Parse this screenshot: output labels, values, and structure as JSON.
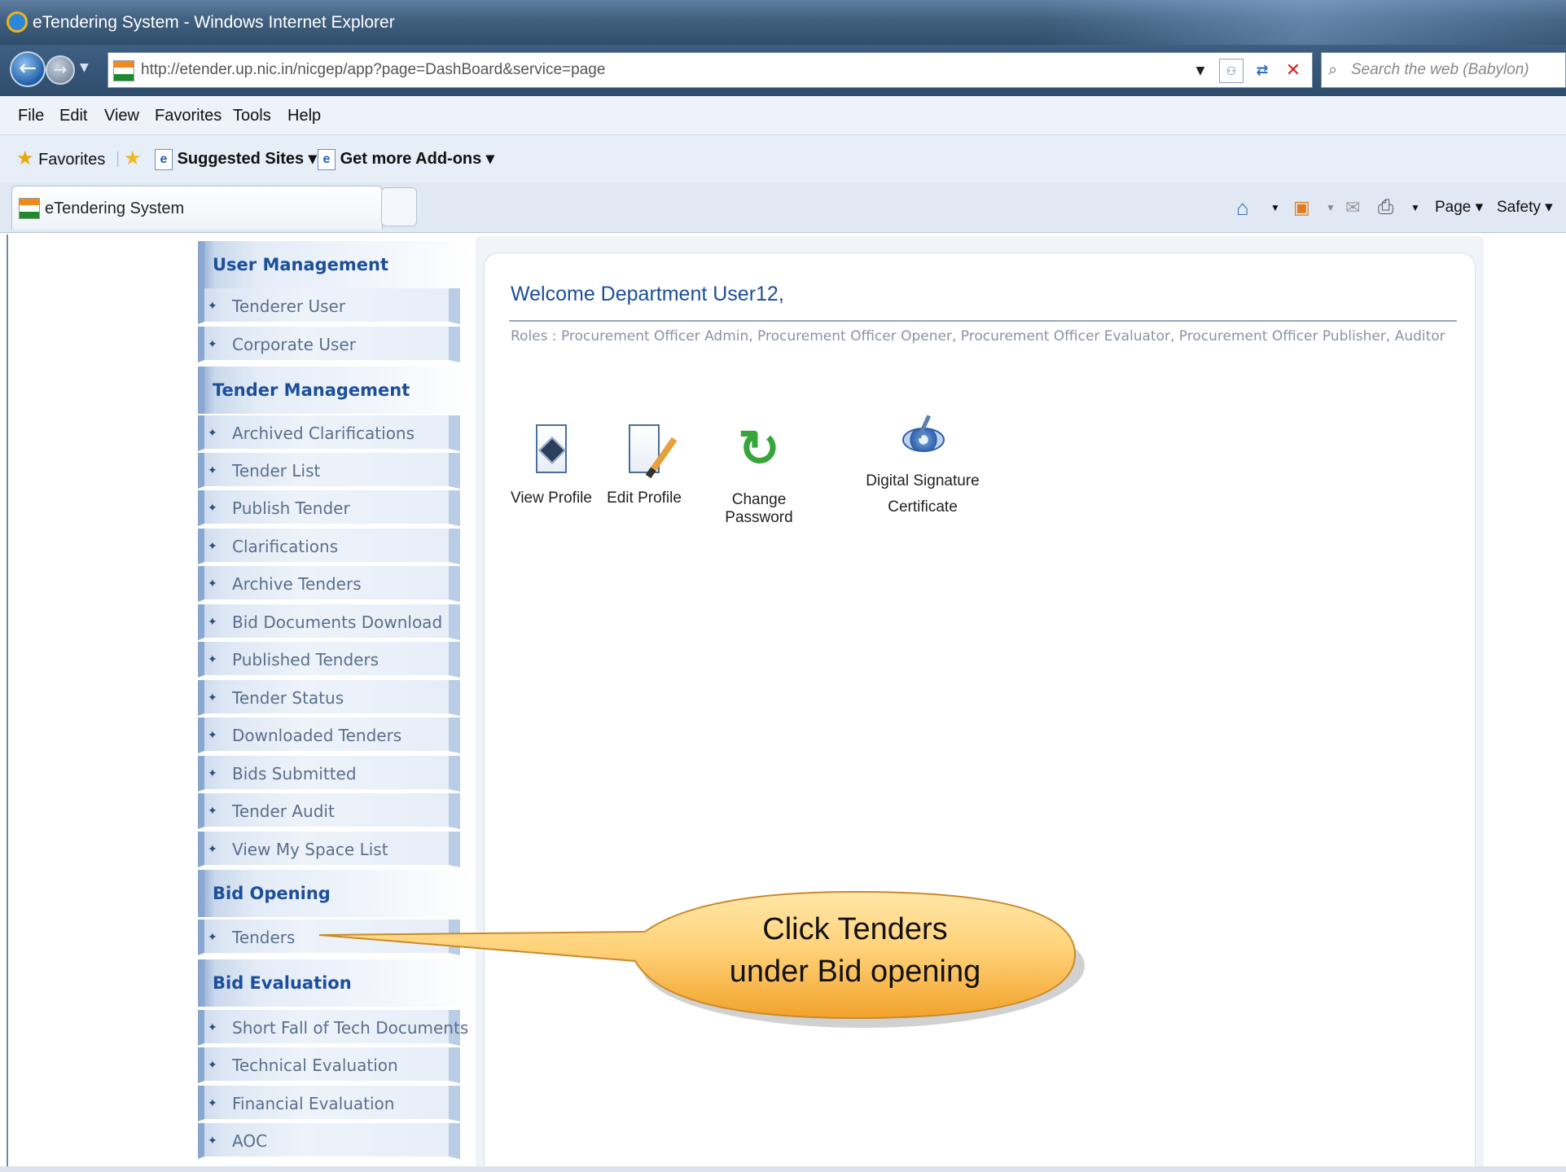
{
  "window": {
    "title": "eTendering System - Windows Internet Explorer"
  },
  "address": {
    "url": "http://etender.up.nic.in/nicgep/app?page=DashBoard&service=page",
    "search_placeholder": "Search the web (Babylon)"
  },
  "menu": [
    "File",
    "Edit",
    "View",
    "Favorites",
    "Tools",
    "Help"
  ],
  "favorites_bar": {
    "favorites_label": "Favorites",
    "suggested_sites": "Suggested Sites ▾",
    "addons": "Get more Add-ons ▾"
  },
  "tab": {
    "title": "eTendering System"
  },
  "command_bar": {
    "page_label": "Page ▾",
    "safety_label": "Safety ▾"
  },
  "sidebar": {
    "sections": [
      {
        "heading": "User Management",
        "items": [
          "Tenderer User",
          "Corporate User"
        ]
      },
      {
        "heading": "Tender Management",
        "items": [
          "Archived Clarifications",
          "Tender List",
          "Publish Tender",
          "Clarifications",
          "Archive Tenders",
          "Bid Documents Download",
          "Published Tenders",
          "Tender Status",
          "Downloaded Tenders",
          "Bids Submitted",
          "Tender Audit",
          "View My Space List"
        ]
      },
      {
        "heading": "Bid Opening",
        "items": [
          "Tenders"
        ]
      },
      {
        "heading": "Bid Evaluation",
        "items": [
          "Short Fall of Tech Documents",
          "Technical Evaluation",
          "Financial Evaluation",
          "AOC"
        ]
      }
    ]
  },
  "main": {
    "welcome": "Welcome Department User12,",
    "roles": "Roles : Procurement Officer Admin, Procurement Officer Opener, Procurement Officer Evaluator, Procurement Officer Publisher, Auditor",
    "quick_links": {
      "view_profile": "View Profile",
      "edit_profile": "Edit Profile",
      "change_password": "Change Password",
      "dsc_line1": "Digital Signature",
      "dsc_line2": "Certificate"
    }
  },
  "callout": {
    "line1": "Click Tenders",
    "line2": "under Bid opening"
  },
  "colors": {
    "accent": "#1c4f9a",
    "callout_fill": "#f7b84a"
  }
}
